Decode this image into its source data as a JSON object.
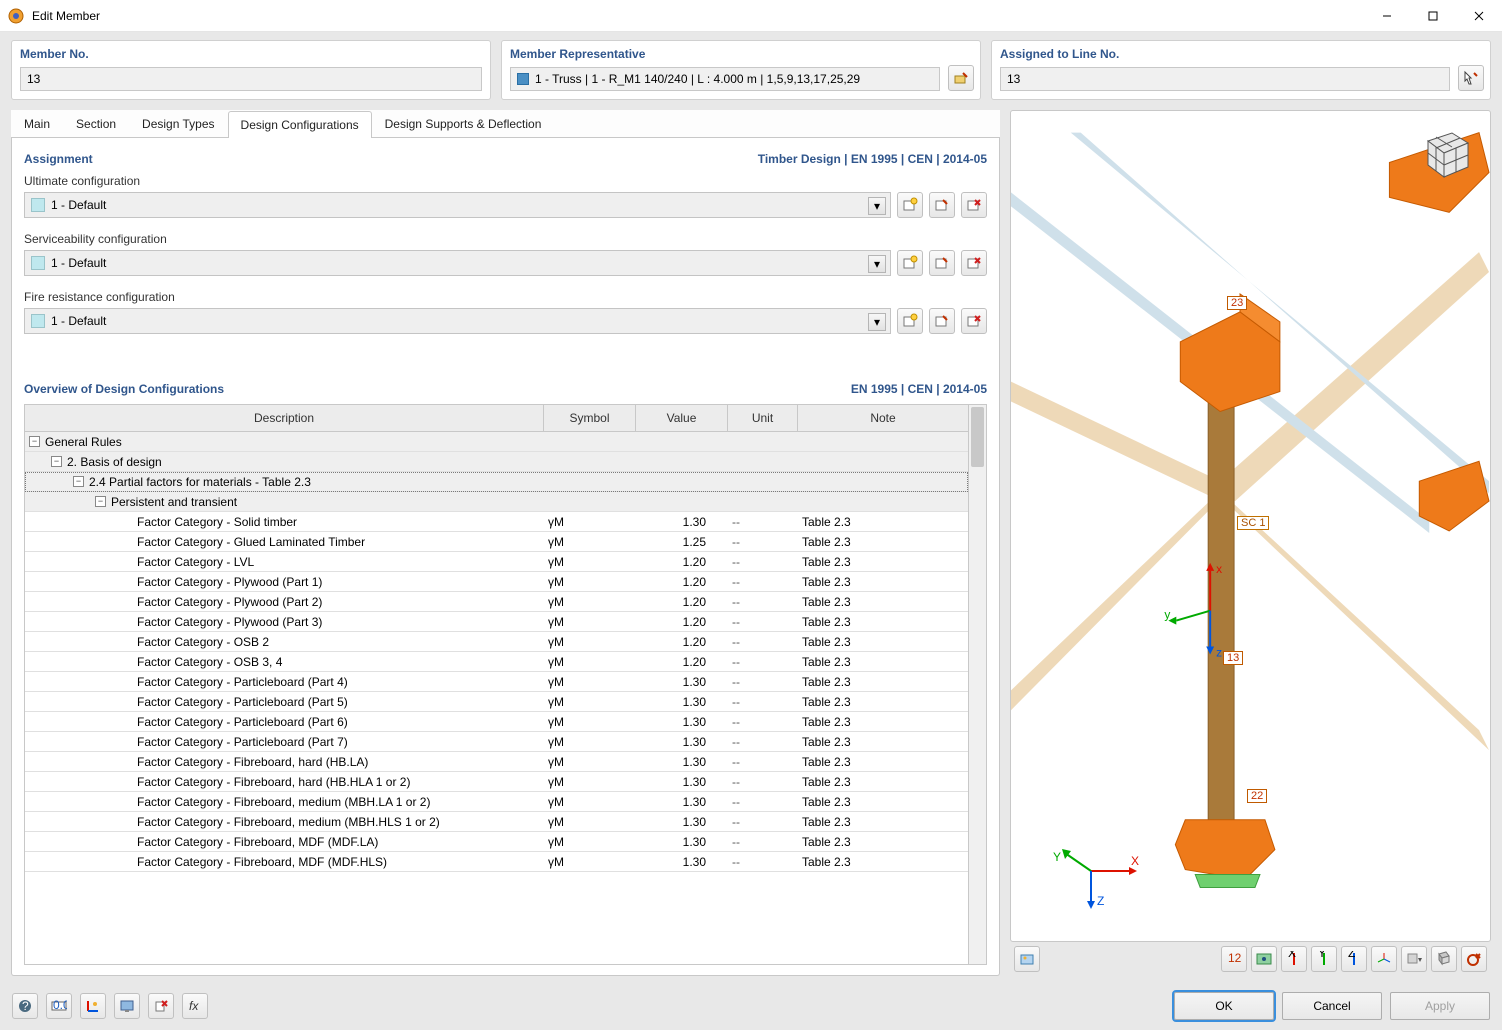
{
  "window": {
    "title": "Edit Member"
  },
  "header": {
    "member_no": {
      "label": "Member No.",
      "value": "13"
    },
    "representative": {
      "label": "Member Representative",
      "value": "1 - Truss | 1 - R_M1 140/240 | L : 4.000 m | 1,5,9,13,17,25,29"
    },
    "assigned_line": {
      "label": "Assigned to Line No.",
      "value": "13"
    }
  },
  "tabs": {
    "items": [
      "Main",
      "Section",
      "Design Types",
      "Design Configurations",
      "Design Supports & Deflection"
    ],
    "active_index": 3
  },
  "assignment": {
    "heading": "Assignment",
    "standard": "Timber Design | EN 1995 | CEN | 2014-05",
    "ultimate": {
      "label": "Ultimate configuration",
      "value": "1 - Default"
    },
    "serviceability": {
      "label": "Serviceability configuration",
      "value": "1 - Default"
    },
    "fire": {
      "label": "Fire resistance configuration",
      "value": "1 - Default"
    }
  },
  "overview": {
    "heading": "Overview of Design Configurations",
    "standard": "EN 1995 | CEN | 2014-05",
    "columns": {
      "description": "Description",
      "symbol": "Symbol",
      "value": "Value",
      "unit": "Unit",
      "note": "Note"
    },
    "groups": {
      "g1": "General Rules",
      "g2": "2. Basis of design",
      "g3": "2.4 Partial factors for materials - Table 2.3",
      "g4": "Persistent and transient"
    },
    "rows": [
      {
        "desc": "Factor Category - Solid timber",
        "sym": "γM",
        "val": "1.30",
        "unit": "--",
        "note": "Table 2.3"
      },
      {
        "desc": "Factor Category - Glued Laminated Timber",
        "sym": "γM",
        "val": "1.25",
        "unit": "--",
        "note": "Table 2.3"
      },
      {
        "desc": "Factor Category - LVL",
        "sym": "γM",
        "val": "1.20",
        "unit": "--",
        "note": "Table 2.3"
      },
      {
        "desc": "Factor Category - Plywood (Part 1)",
        "sym": "γM",
        "val": "1.20",
        "unit": "--",
        "note": "Table 2.3"
      },
      {
        "desc": "Factor Category - Plywood (Part 2)",
        "sym": "γM",
        "val": "1.20",
        "unit": "--",
        "note": "Table 2.3"
      },
      {
        "desc": "Factor Category - Plywood (Part 3)",
        "sym": "γM",
        "val": "1.20",
        "unit": "--",
        "note": "Table 2.3"
      },
      {
        "desc": "Factor Category - OSB 2",
        "sym": "γM",
        "val": "1.20",
        "unit": "--",
        "note": "Table 2.3"
      },
      {
        "desc": "Factor Category - OSB 3, 4",
        "sym": "γM",
        "val": "1.20",
        "unit": "--",
        "note": "Table 2.3"
      },
      {
        "desc": "Factor Category - Particleboard (Part 4)",
        "sym": "γM",
        "val": "1.30",
        "unit": "--",
        "note": "Table 2.3"
      },
      {
        "desc": "Factor Category - Particleboard (Part 5)",
        "sym": "γM",
        "val": "1.30",
        "unit": "--",
        "note": "Table 2.3"
      },
      {
        "desc": "Factor Category - Particleboard (Part 6)",
        "sym": "γM",
        "val": "1.30",
        "unit": "--",
        "note": "Table 2.3"
      },
      {
        "desc": "Factor Category - Particleboard (Part 7)",
        "sym": "γM",
        "val": "1.30",
        "unit": "--",
        "note": "Table 2.3"
      },
      {
        "desc": "Factor Category - Fibreboard, hard (HB.LA)",
        "sym": "γM",
        "val": "1.30",
        "unit": "--",
        "note": "Table 2.3"
      },
      {
        "desc": "Factor Category - Fibreboard, hard (HB.HLA 1 or 2)",
        "sym": "γM",
        "val": "1.30",
        "unit": "--",
        "note": "Table 2.3"
      },
      {
        "desc": "Factor Category - Fibreboard, medium (MBH.LA 1 or 2)",
        "sym": "γM",
        "val": "1.30",
        "unit": "--",
        "note": "Table 2.3"
      },
      {
        "desc": "Factor Category - Fibreboard, medium (MBH.HLS 1 or 2)",
        "sym": "γM",
        "val": "1.30",
        "unit": "--",
        "note": "Table 2.3"
      },
      {
        "desc": "Factor Category - Fibreboard, MDF (MDF.LA)",
        "sym": "γM",
        "val": "1.30",
        "unit": "--",
        "note": "Table 2.3"
      },
      {
        "desc": "Factor Category - Fibreboard, MDF (MDF.HLS)",
        "sym": "γM",
        "val": "1.30",
        "unit": "--",
        "note": "Table 2.3"
      }
    ]
  },
  "view3d_labels": {
    "n23": "23",
    "n22": "22",
    "n13": "13",
    "sc": "SC 1"
  },
  "buttons": {
    "ok": "OK",
    "cancel": "Cancel",
    "apply": "Apply"
  }
}
